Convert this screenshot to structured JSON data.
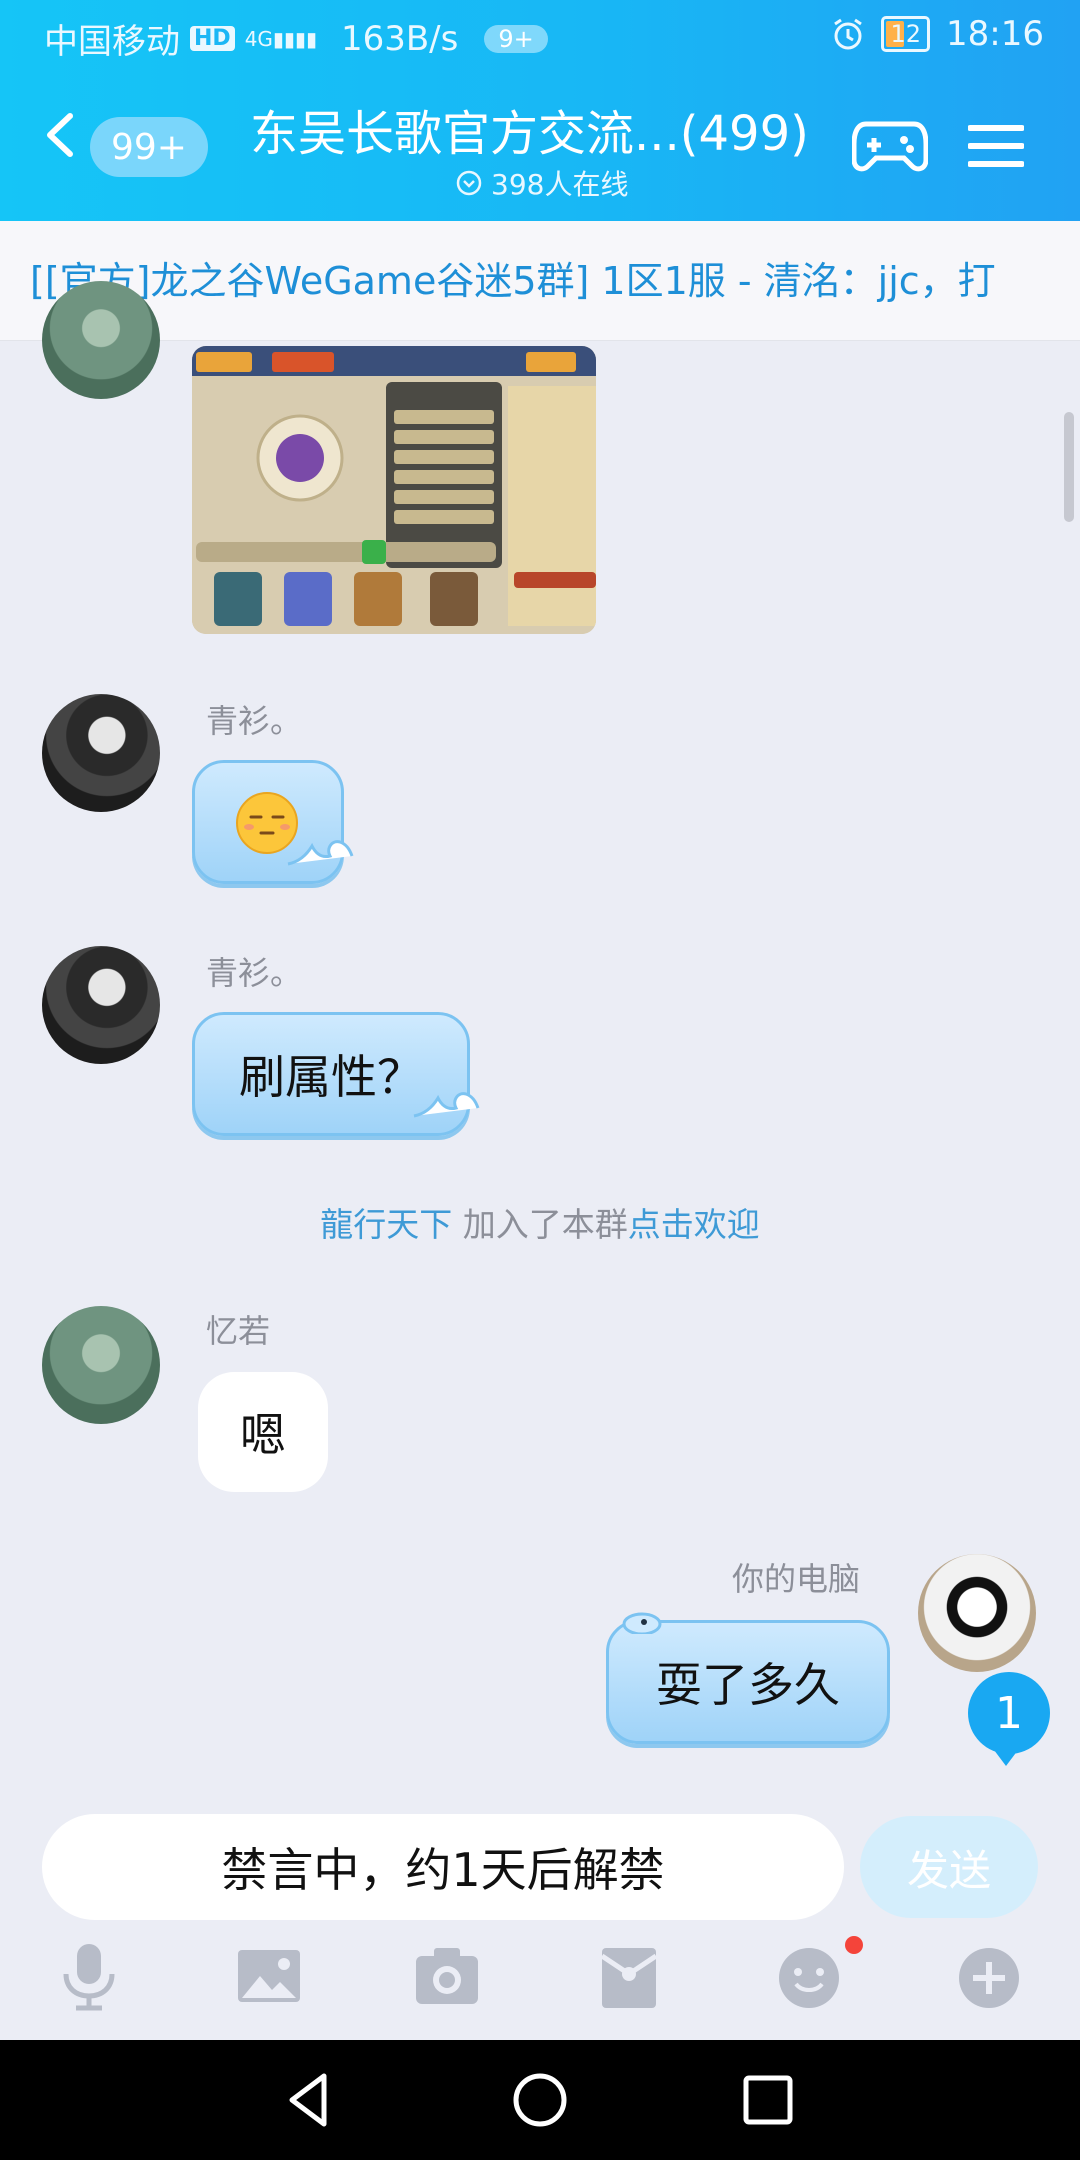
{
  "status_bar": {
    "carrier": "中国移动",
    "hd": "HD",
    "signal": "4G",
    "speed": "163B/s",
    "notif_count": "9+",
    "battery": "12",
    "time": "18:16"
  },
  "header": {
    "unread": "99+",
    "title": "东吴长歌官方交流...(499)",
    "online": "398人在线"
  },
  "marquee": "[[官方]龙之谷WeGame谷迷5群] 1区1服 - 清洺：jjc，打",
  "messages": [
    {
      "sender": "青衫。",
      "text": ""
    },
    {
      "sender": "青衫。",
      "text": "刷属性？"
    },
    {
      "sender": "忆若",
      "text": "嗯"
    },
    {
      "sender": "你的电脑",
      "text": "耍了多久"
    }
  ],
  "system": {
    "user": "龍行天下",
    "action": " 加入了本群",
    "link": "点击欢迎"
  },
  "unread_float": "1",
  "input": {
    "placeholder": "禁言中，约1天后解禁",
    "send": "发送"
  },
  "colors": {
    "header_start": "#15c5f7",
    "header_end": "#21a2f3",
    "link": "#3e9ad6",
    "bubble_blue": "#9fd3f8"
  }
}
